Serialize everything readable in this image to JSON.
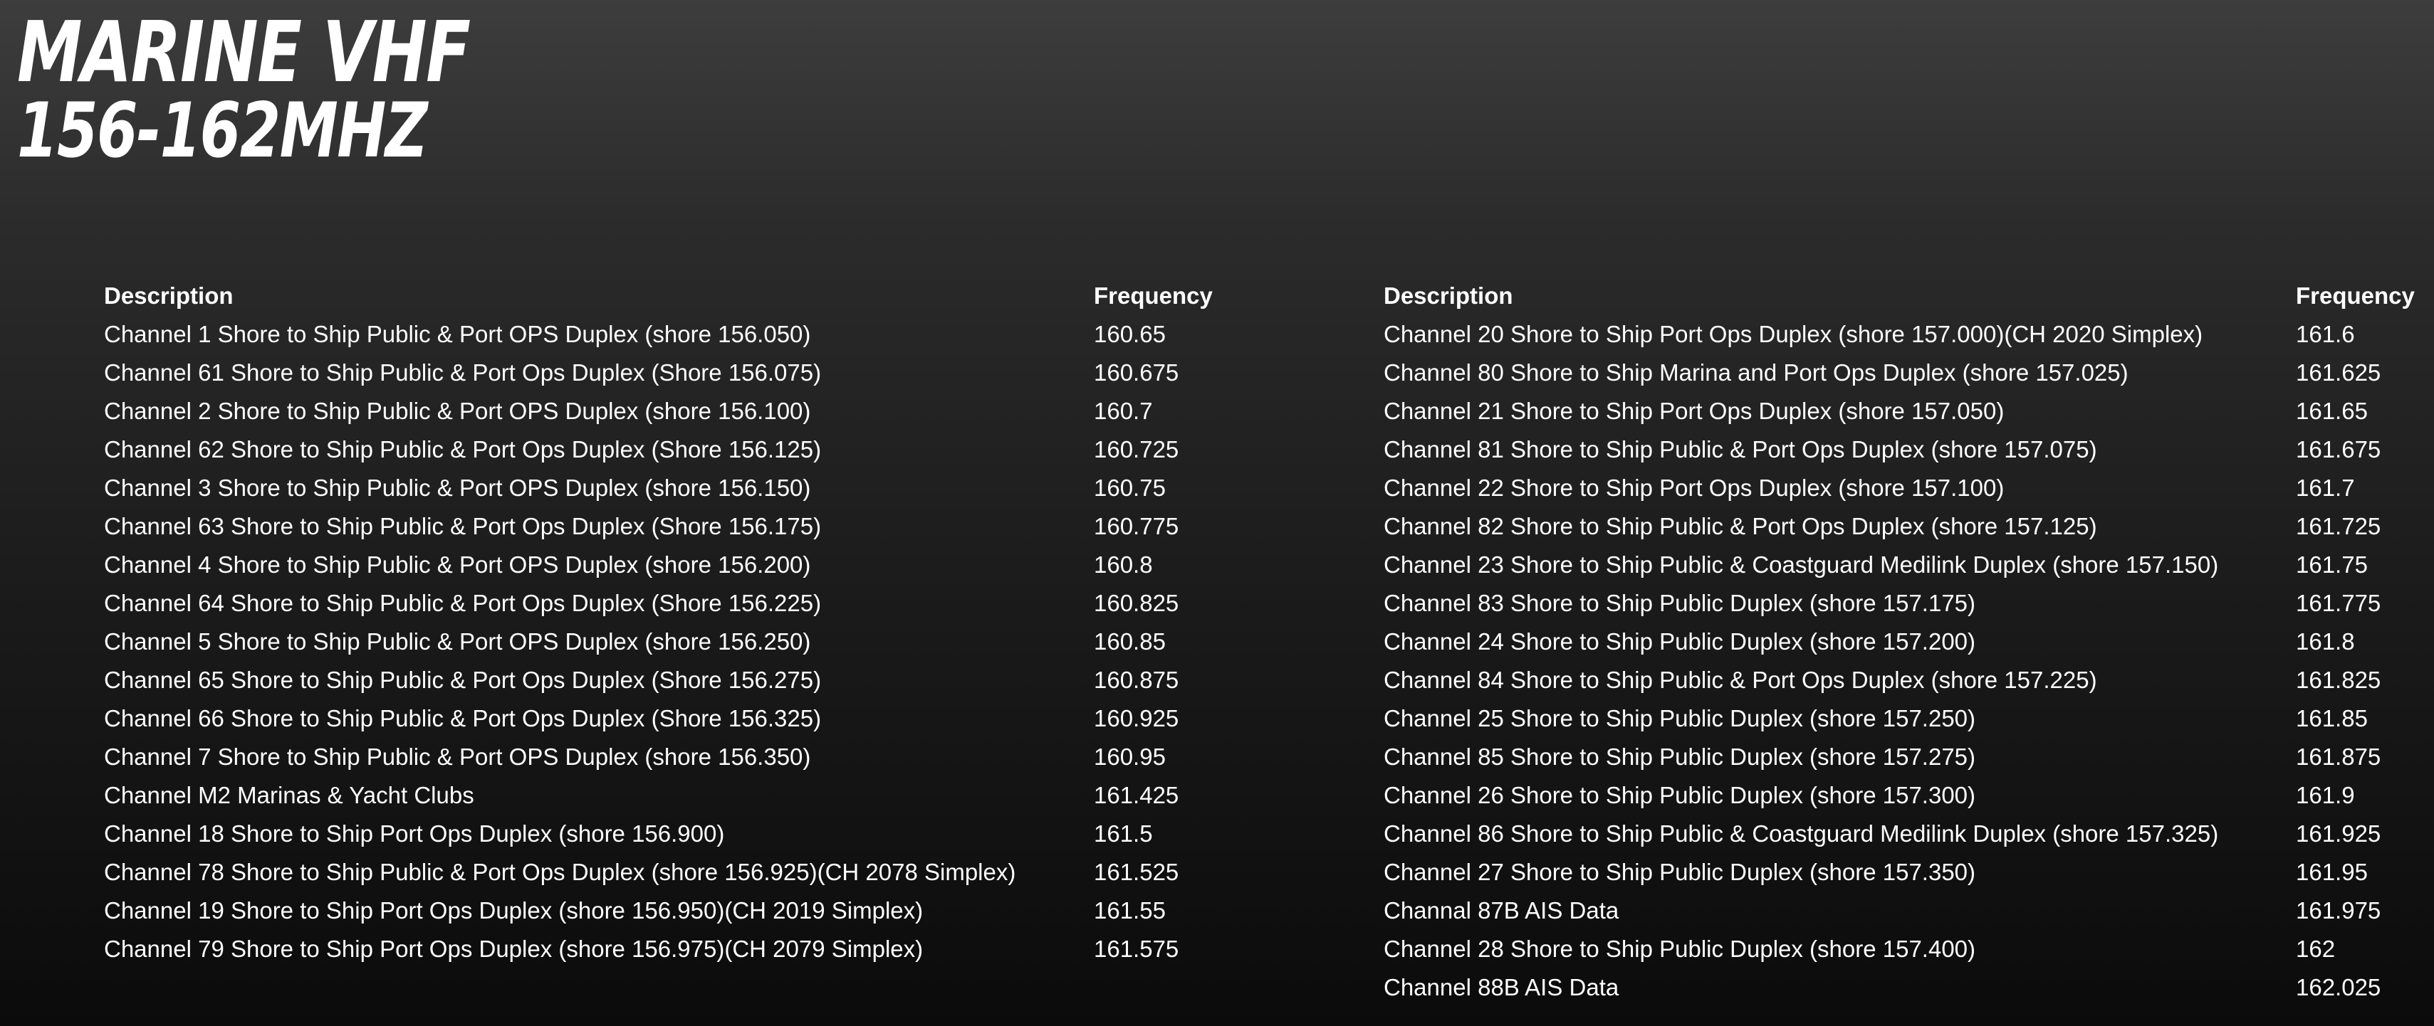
{
  "title": {
    "line1": "MARINE VHF",
    "line2": "156-162MHZ"
  },
  "left_table": {
    "headers": {
      "description": "Description",
      "frequency": "Frequency"
    },
    "rows": [
      {
        "description": "Channel 1 Shore to Ship Public & Port OPS Duplex (shore 156.050)",
        "frequency": "160.65"
      },
      {
        "description": "Channel 61 Shore to Ship Public & Port Ops Duplex (Shore 156.075)",
        "frequency": "160.675"
      },
      {
        "description": "Channel 2 Shore to Ship Public & Port OPS Duplex (shore 156.100)",
        "frequency": "160.7"
      },
      {
        "description": "Channel 62 Shore to Ship Public & Port Ops Duplex (Shore 156.125)",
        "frequency": "160.725"
      },
      {
        "description": "Channel 3 Shore to Ship Public & Port OPS Duplex (shore 156.150)",
        "frequency": "160.75"
      },
      {
        "description": "Channel 63 Shore to Ship Public & Port Ops Duplex (Shore 156.175)",
        "frequency": "160.775"
      },
      {
        "description": "Channel 4 Shore to Ship Public & Port OPS Duplex (shore 156.200)",
        "frequency": "160.8"
      },
      {
        "description": "Channel 64 Shore to Ship Public & Port Ops Duplex (Shore 156.225)",
        "frequency": "160.825"
      },
      {
        "description": "Channel 5 Shore to Ship Public & Port OPS Duplex (shore 156.250)",
        "frequency": "160.85"
      },
      {
        "description": "Channel 65 Shore to Ship Public & Port Ops Duplex (Shore 156.275)",
        "frequency": "160.875"
      },
      {
        "description": "Channel 66 Shore to Ship Public & Port Ops Duplex (Shore 156.325)",
        "frequency": "160.925"
      },
      {
        "description": "Channel 7 Shore to Ship Public & Port OPS Duplex (shore 156.350)",
        "frequency": "160.95"
      },
      {
        "description": "Channel M2 Marinas & Yacht Clubs",
        "frequency": "161.425"
      },
      {
        "description": "Channel 18 Shore to Ship Port Ops Duplex (shore 156.900)",
        "frequency": "161.5"
      },
      {
        "description": "Channel 78 Shore to Ship Public & Port Ops Duplex (shore 156.925)(CH 2078 Simplex)",
        "frequency": "161.525"
      },
      {
        "description": "Channel 19 Shore to Ship Port Ops Duplex (shore 156.950)(CH 2019 Simplex)",
        "frequency": "161.55"
      },
      {
        "description": "Channel 79 Shore to Ship Port Ops Duplex (shore 156.975)(CH 2079 Simplex)",
        "frequency": "161.575"
      }
    ]
  },
  "right_table": {
    "headers": {
      "description": "Description",
      "frequency": "Frequency"
    },
    "rows": [
      {
        "description": "Channel 20 Shore to Ship Port Ops Duplex (shore 157.000)(CH 2020 Simplex)",
        "frequency": "161.6"
      },
      {
        "description": "Channel 80 Shore to Ship Marina and Port Ops Duplex (shore 157.025)",
        "frequency": "161.625"
      },
      {
        "description": "Channel 21 Shore to Ship Port Ops Duplex (shore 157.050)",
        "frequency": "161.65"
      },
      {
        "description": "Channel 81 Shore to Ship Public & Port Ops Duplex (shore 157.075)",
        "frequency": "161.675"
      },
      {
        "description": "Channel 22 Shore to Ship Port Ops Duplex (shore 157.100)",
        "frequency": "161.7"
      },
      {
        "description": "Channel 82 Shore to Ship Public & Port Ops Duplex (shore 157.125)",
        "frequency": "161.725"
      },
      {
        "description": "Channel 23 Shore to Ship Public & Coastguard Medilink Duplex (shore 157.150)",
        "frequency": "161.75"
      },
      {
        "description": "Channel 83 Shore to Ship Public Duplex (shore 157.175)",
        "frequency": "161.775"
      },
      {
        "description": "Channel 24 Shore to Ship Public Duplex (shore 157.200)",
        "frequency": "161.8"
      },
      {
        "description": "Channel 84 Shore to Ship Public & Port Ops Duplex (shore 157.225)",
        "frequency": "161.825"
      },
      {
        "description": "Channel 25 Shore to Ship Public Duplex (shore 157.250)",
        "frequency": "161.85"
      },
      {
        "description": "Channel 85 Shore to Ship Public Duplex (shore 157.275)",
        "frequency": "161.875"
      },
      {
        "description": "Channel 26 Shore to Ship Public Duplex (shore 157.300)",
        "frequency": "161.9"
      },
      {
        "description": "Channel 86 Shore to Ship Public & Coastguard Medilink Duplex (shore 157.325)",
        "frequency": "161.925"
      },
      {
        "description": "Channel 27 Shore to Ship Public Duplex (shore 157.350)",
        "frequency": "161.95"
      },
      {
        "description": "Channal 87B AIS Data",
        "frequency": "161.975"
      },
      {
        "description": "Channel 28 Shore to Ship Public Duplex (shore 157.400)",
        "frequency": "162"
      },
      {
        "description": "Channel 88B AIS Data",
        "frequency": "162.025"
      }
    ]
  }
}
